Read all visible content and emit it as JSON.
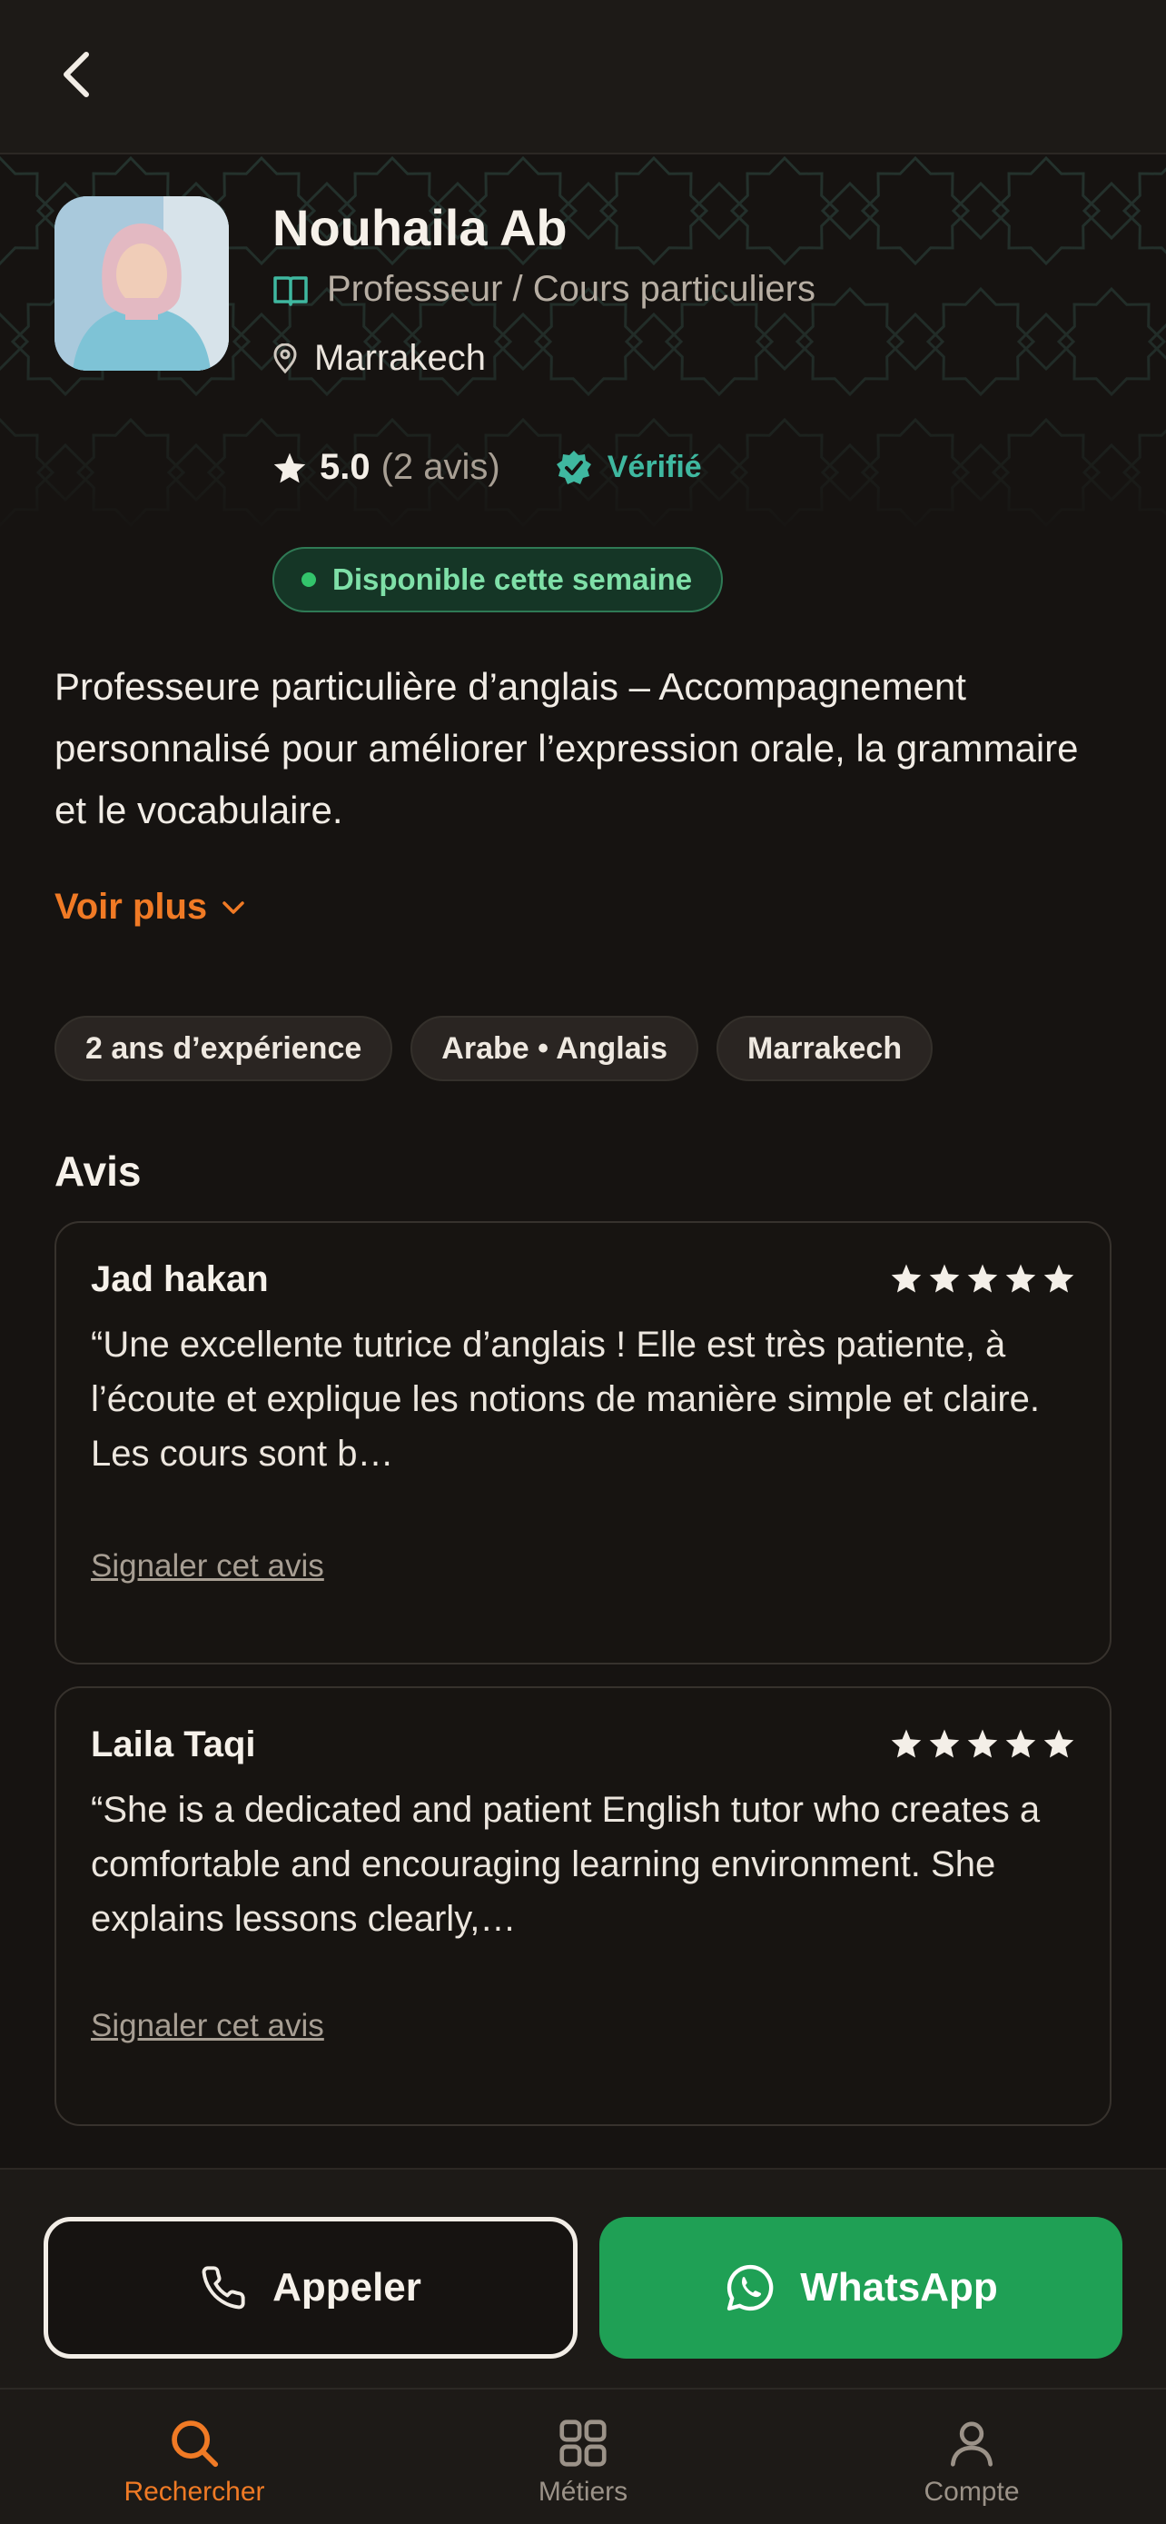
{
  "colors": {
    "accent": "#f07a25",
    "whatsapp": "#1fa055",
    "verified": "#3fb8a0",
    "available": "#7fe0a8",
    "background": "#161311"
  },
  "header": {
    "back_icon": "chevron-left-icon"
  },
  "profile": {
    "name": "Nouhaila Ab",
    "profession": "Professeur / Cours particuliers",
    "city": "Marrakech",
    "rating": "5.0",
    "rating_count": "(2 avis)",
    "verified_label": "Vérifié",
    "availability": "Disponible cette semaine",
    "description": "Professeure particulière d’anglais – Accompagnement personnalisé pour améliorer l’expression orale, la grammaire et le vocabulaire.",
    "see_more": "Voir plus"
  },
  "chips": [
    "2 ans d’expérience",
    "Arabe • Anglais",
    "Marrakech"
  ],
  "reviews_section": {
    "title": "Avis",
    "items": [
      {
        "author": "Jad hakan",
        "stars": 5,
        "text": "“Une excellente tutrice d’anglais ! Elle est très patiente, à l’écoute et explique les notions de manière simple et claire. Les cours sont b…",
        "report": "Signaler cet avis"
      },
      {
        "author": "Laila Taqi",
        "stars": 5,
        "text": "“She is a dedicated and patient English tutor who creates a comfortable and encouraging learning environment. She explains lessons clearly,…",
        "report": "Signaler cet avis"
      }
    ]
  },
  "actions": {
    "call": "Appeler",
    "whatsapp": "WhatsApp"
  },
  "tabbar": {
    "search": "Rechercher",
    "trades": "Métiers",
    "account": "Compte"
  }
}
